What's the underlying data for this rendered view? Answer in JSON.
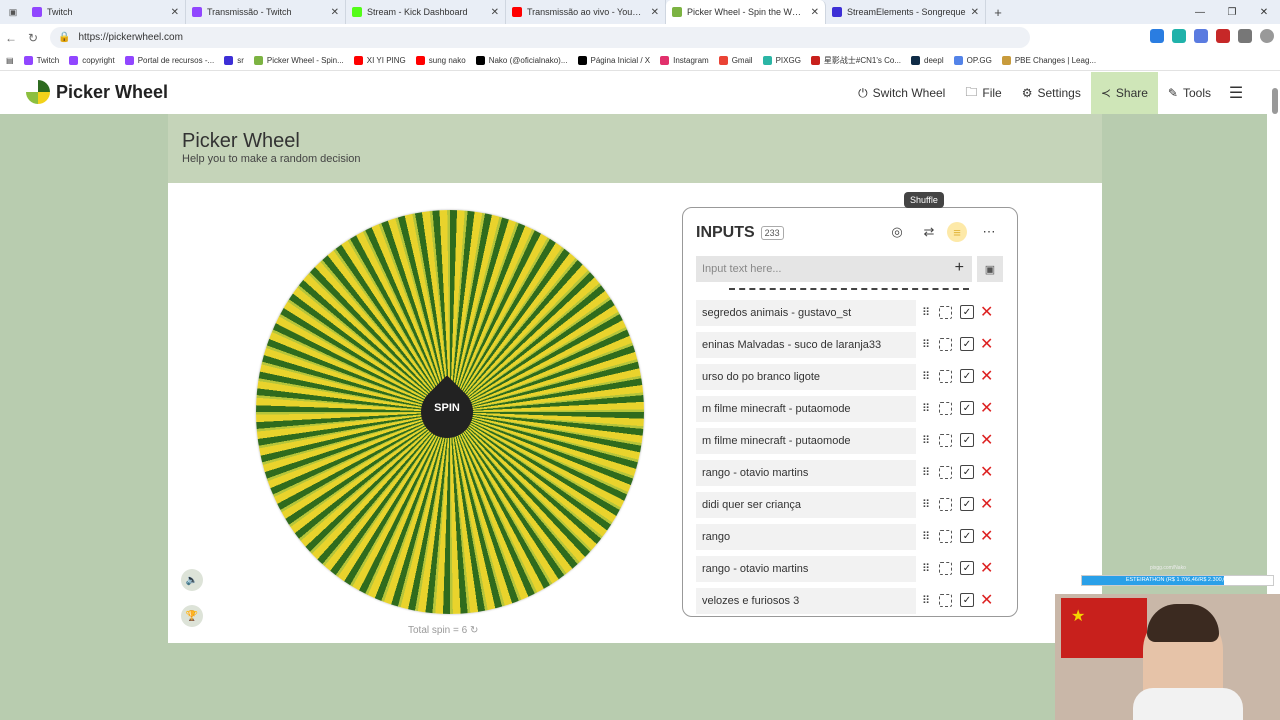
{
  "browser": {
    "tabs": [
      {
        "title": "Twitch",
        "color": "#9146ff"
      },
      {
        "title": "Transmissão - Twitch",
        "color": "#9146ff"
      },
      {
        "title": "Stream - Kick Dashboard",
        "color": "#53fc18"
      },
      {
        "title": "Transmissão ao vivo - YouTube St",
        "color": "#ff0000"
      },
      {
        "title": "Picker Wheel - Spin the Wheel to",
        "color": "#7cb342",
        "active": true
      },
      {
        "title": "StreamElements - Songreque",
        "color": "#3d2fd6"
      }
    ],
    "url": "https://pickerwheel.com",
    "bookmarks": [
      {
        "label": "Twitch",
        "color": "#9146ff"
      },
      {
        "label": "copyright",
        "color": "#9146ff"
      },
      {
        "label": "Portal de recursos -...",
        "color": "#9146ff"
      },
      {
        "label": "sr",
        "color": "#3d2fd6"
      },
      {
        "label": "Picker Wheel - Spin...",
        "color": "#7cb342"
      },
      {
        "label": "XI YI PING",
        "color": "#ff0000"
      },
      {
        "label": "sung nako",
        "color": "#ff0000"
      },
      {
        "label": "Nako (@oficialnako)...",
        "color": "#000000"
      },
      {
        "label": "Página Inicial / X",
        "color": "#000000"
      },
      {
        "label": "Instagram",
        "color": "#e1306c"
      },
      {
        "label": "Gmail",
        "color": "#ea4335"
      },
      {
        "label": "PIXGG",
        "color": "#2bb5a5"
      },
      {
        "label": "星影战士#CN1's Co...",
        "color": "#c8201c"
      },
      {
        "label": "deepl",
        "color": "#0f2b46"
      },
      {
        "label": "OP.GG",
        "color": "#5383e8"
      },
      {
        "label": "PBE Changes | Leag...",
        "color": "#c89b3c"
      }
    ]
  },
  "site": {
    "brand": "Picker Wheel",
    "nav": {
      "switch_wheel": "Switch Wheel",
      "file": "File",
      "settings": "Settings",
      "share": "Share",
      "tools": "Tools"
    },
    "hero": {
      "title": "Picker Wheel",
      "subtitle": "Help you to make a random decision"
    },
    "wheel": {
      "spin_label": "SPIN",
      "total_spin": "Total spin = 6"
    },
    "inputs": {
      "title": "INPUTS",
      "count": "233",
      "tooltip": "Shuffle",
      "placeholder": "Input text here...",
      "items": [
        "segredos animais - gustavo_st",
        "eninas Malvadas - suco de laranja33",
        "urso do po branco ligote",
        "m filme minecraft - putaomode",
        "m filme minecraft - putaomode",
        "rango - otavio martins",
        "didi quer ser criança",
        "rango",
        "rango - otavio martins",
        "velozes e furiosos 3"
      ]
    }
  },
  "overlay": {
    "donation_url": "pixgg.com/Nako",
    "donation_goal": "ESTEIRATHON (R$ 1.706,46/R$ 2.300,00)",
    "donation_progress": 0.742
  }
}
